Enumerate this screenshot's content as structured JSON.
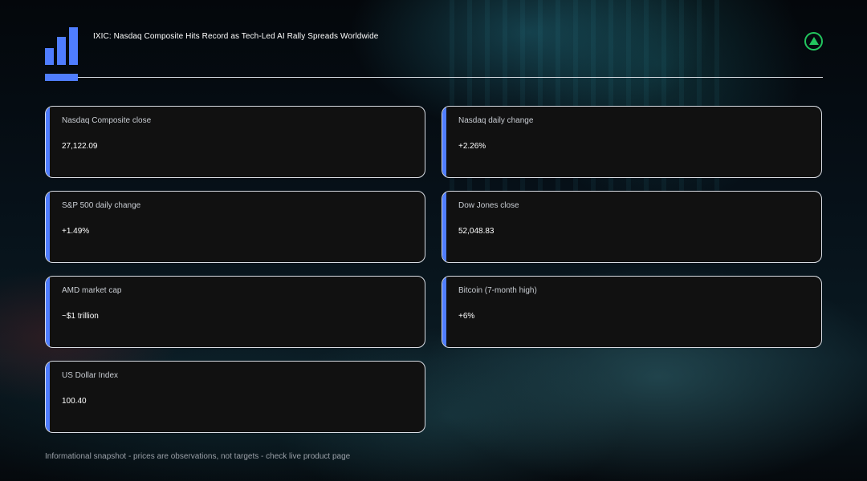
{
  "header": {
    "headline": "IXIC: Nasdaq Composite Hits Record as Tech-Led AI Rally Spreads Worldwide",
    "logo_icon": "bar-chart-logo-icon",
    "status_icon": "up-triangle-circle-icon",
    "status_color": "#22c55e",
    "accent_color": "#4f7dff"
  },
  "cards": [
    {
      "label": "Nasdaq Composite close",
      "value": "27,122.09"
    },
    {
      "label": "Nasdaq daily change",
      "value": "+2.26%"
    },
    {
      "label": "S&P 500 daily change",
      "value": "+1.49%"
    },
    {
      "label": "Dow Jones close",
      "value": "52,048.83"
    },
    {
      "label": "AMD market cap",
      "value": "~$1 trillion"
    },
    {
      "label": "Bitcoin (7-month high)",
      "value": "+6%"
    },
    {
      "label": "US Dollar Index",
      "value": "100.40"
    }
  ],
  "footer": {
    "note": "Informational snapshot - prices are observations, not targets - check live product page"
  }
}
